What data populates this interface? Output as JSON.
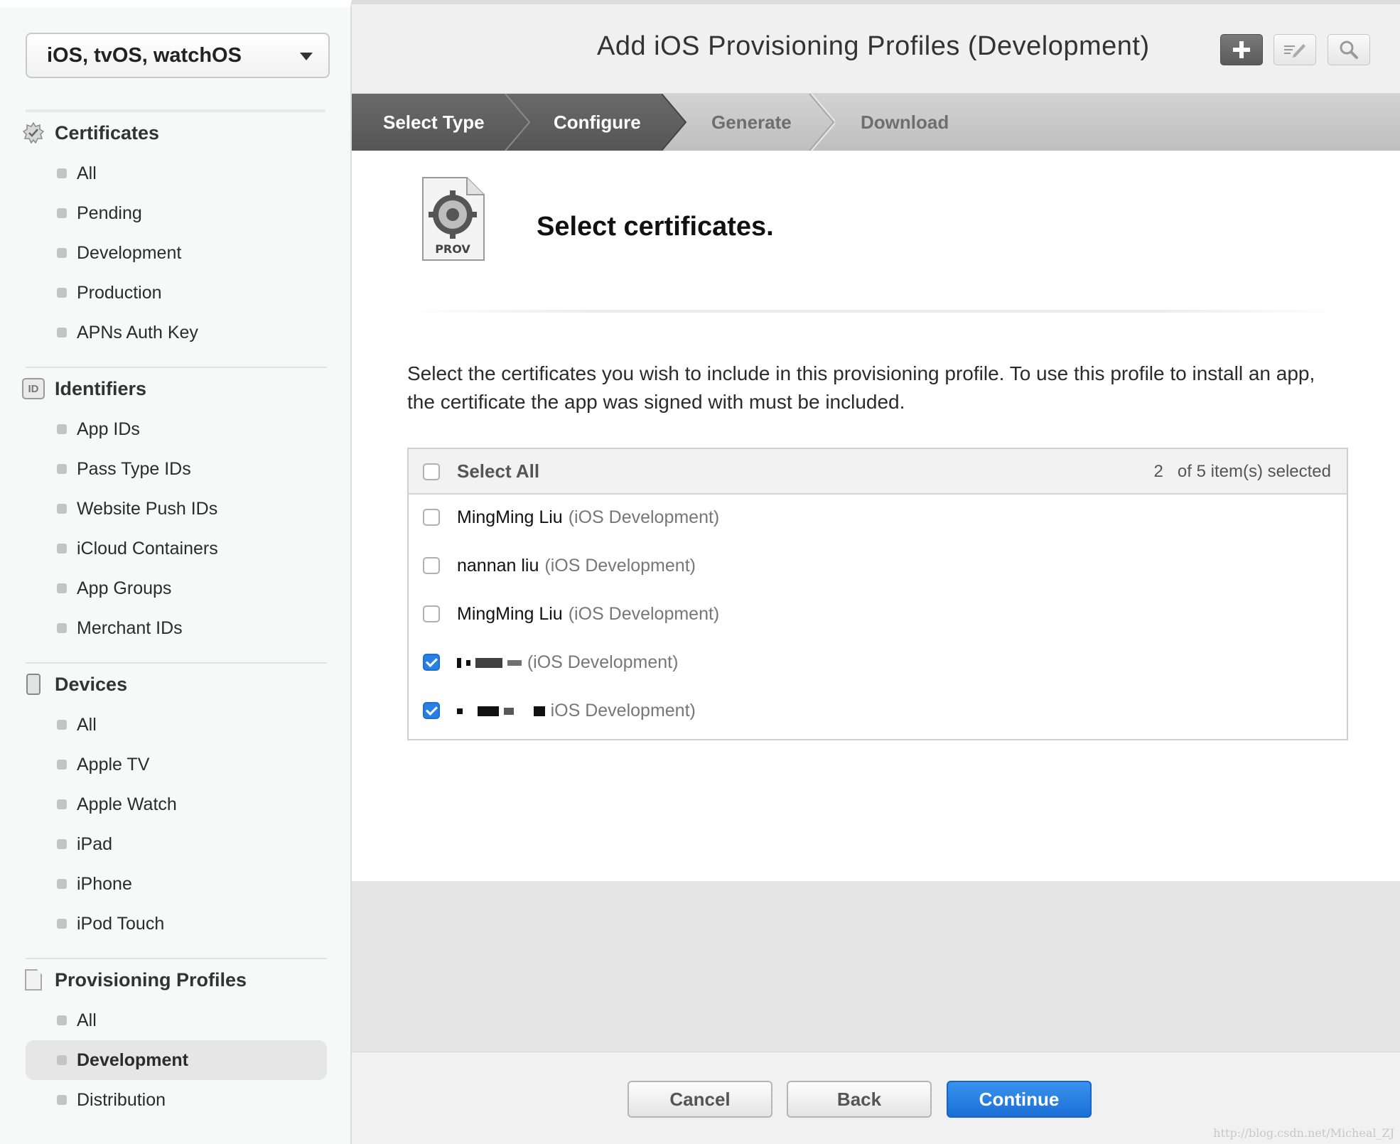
{
  "sidebar": {
    "platform": "iOS, tvOS, watchOS",
    "sections": [
      {
        "title": "Certificates",
        "items": [
          "All",
          "Pending",
          "Development",
          "Production",
          "APNs Auth Key"
        ]
      },
      {
        "title": "Identifiers",
        "badge": "ID",
        "items": [
          "App IDs",
          "Pass Type IDs",
          "Website Push IDs",
          "iCloud Containers",
          "App Groups",
          "Merchant IDs"
        ]
      },
      {
        "title": "Devices",
        "items": [
          "All",
          "Apple TV",
          "Apple Watch",
          "iPad",
          "iPhone",
          "iPod Touch"
        ]
      },
      {
        "title": "Provisioning Profiles",
        "items": [
          "All",
          "Development",
          "Distribution"
        ],
        "active_item": "Development"
      }
    ]
  },
  "header": {
    "title": "Add iOS Provisioning Profiles (Development)"
  },
  "steps": [
    "Select Type",
    "Configure",
    "Generate",
    "Download"
  ],
  "content": {
    "icon_label": "PROV",
    "section_title": "Select certificates.",
    "instructions": "Select the certificates you wish to include in this provisioning profile. To use this profile to install an app, the certificate the app was signed with must be included.",
    "select_all_label": "Select All",
    "selected_count": "2",
    "selected_suffix": "of 5 item(s) selected",
    "certificates": [
      {
        "name": "MingMing Liu",
        "type": "(iOS Development)",
        "checked": false
      },
      {
        "name": "nannan liu",
        "type": "(iOS Development)",
        "checked": false
      },
      {
        "name": "MingMing Liu",
        "type": "(iOS Development)",
        "checked": false
      },
      {
        "name": "",
        "type": "(iOS Development)",
        "checked": true
      },
      {
        "name": "",
        "type": "iOS Development)",
        "checked": true
      }
    ]
  },
  "footer": {
    "cancel": "Cancel",
    "back": "Back",
    "continue": "Continue"
  },
  "watermark": "http://blog.csdn.net/Micheal_ZJ",
  "colors": {
    "accent": "#1b6fd6",
    "step_done": "#5e5e5e"
  }
}
